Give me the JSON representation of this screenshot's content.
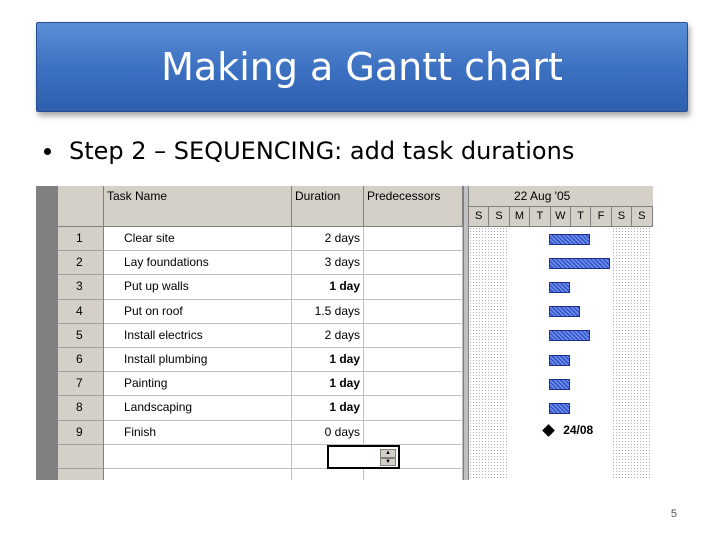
{
  "slide": {
    "title": "Making a Gantt chart",
    "bullet": "Step 2 – SEQUENCING: add task durations",
    "page_number": "5"
  },
  "table": {
    "columns": [
      "",
      "Task Name",
      "Duration",
      "Predecessors"
    ],
    "rows": [
      {
        "id": "1",
        "name": "Clear site",
        "duration": "2 days",
        "predecessors": ""
      },
      {
        "id": "2",
        "name": "Lay foundations",
        "duration": "3 days",
        "predecessors": ""
      },
      {
        "id": "3",
        "name": "Put up walls",
        "duration": "1 day",
        "predecessors": ""
      },
      {
        "id": "4",
        "name": "Put on roof",
        "duration": "1.5 days",
        "predecessors": ""
      },
      {
        "id": "5",
        "name": "Install electrics",
        "duration": "2 days",
        "predecessors": ""
      },
      {
        "id": "6",
        "name": "Install plumbing",
        "duration": "1 day",
        "predecessors": ""
      },
      {
        "id": "7",
        "name": "Painting",
        "duration": "1 day",
        "predecessors": ""
      },
      {
        "id": "8",
        "name": "Landscaping",
        "duration": "1 day",
        "predecessors": ""
      },
      {
        "id": "9",
        "name": "Finish",
        "duration": "0 days",
        "predecessors": ""
      },
      {
        "id": "",
        "name": "",
        "duration": "",
        "predecessors": ""
      },
      {
        "id": "",
        "name": "",
        "duration": "",
        "predecessors": ""
      }
    ]
  },
  "gantt": {
    "week_label": "22 Aug '05",
    "days": [
      "S",
      "S",
      "M",
      "T",
      "W",
      "T",
      "F",
      "S",
      "S"
    ],
    "milestone_label": "24/08",
    "bar_color": "#3a5bd0"
  }
}
